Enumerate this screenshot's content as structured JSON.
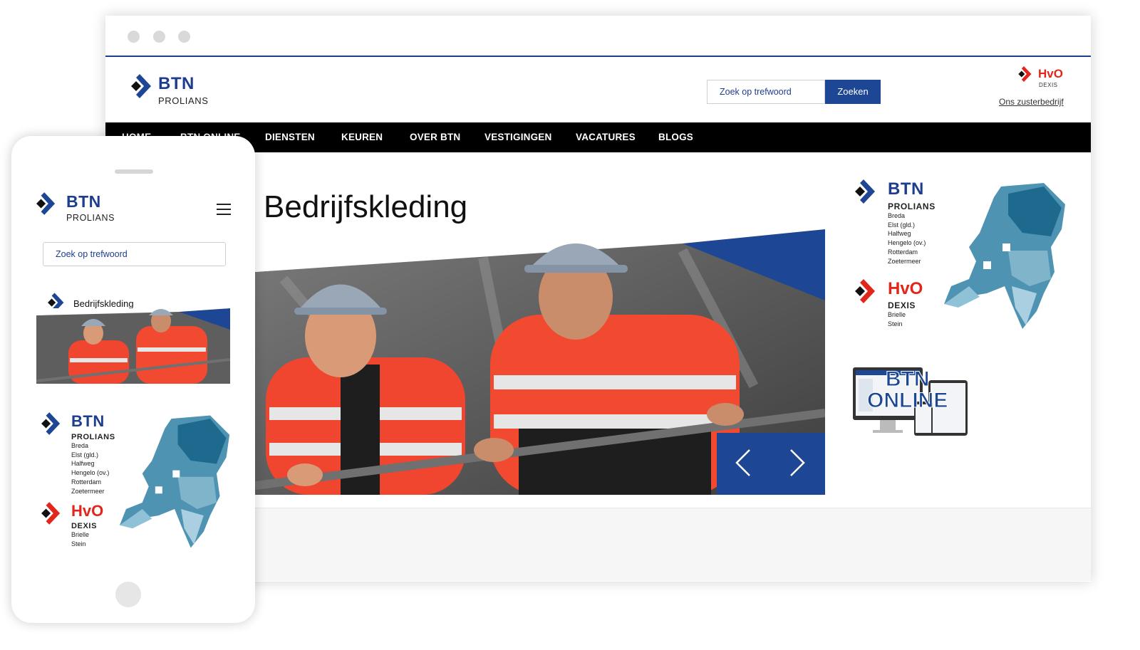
{
  "brand": {
    "name": "BTN",
    "sub": "PROLIANS",
    "colors": {
      "primary": "#1d4794",
      "accent": "#e1261c",
      "nav": "#000000"
    }
  },
  "desktop": {
    "search": {
      "placeholder": "Zoek op trefwoord",
      "button": "Zoeken"
    },
    "sister": {
      "brand": "HvO",
      "sub": "DEXIS",
      "link": "Ons zusterbedrijf"
    },
    "nav": [
      "HOME",
      "BTN ONLINE",
      "DIENSTEN",
      "KEUREN",
      "OVER BTN",
      "VESTIGINGEN",
      "VACATURES",
      "BLOGS"
    ],
    "page_title": "Bedrijfskleding",
    "carousel": {
      "prev_icon": "chevron-left-icon",
      "next_icon": "chevron-right-icon"
    },
    "btn_online": {
      "line1": "BTN",
      "line2": "ONLINE"
    }
  },
  "map_promo": {
    "btn": {
      "name": "BTN",
      "sub": "PROLIANS",
      "locations": [
        "Breda",
        "Elst (gld.)",
        "Halfweg",
        "Hengelo (ov.)",
        "Rotterdam",
        "Zoetermeer"
      ]
    },
    "hvo": {
      "name": "HvO",
      "sub": "DEXIS",
      "locations": [
        "Brielle",
        "Stein"
      ]
    }
  },
  "mobile": {
    "search": {
      "placeholder": "Zoek op trefwoord"
    },
    "page_title": "Bedrijfskleding"
  }
}
